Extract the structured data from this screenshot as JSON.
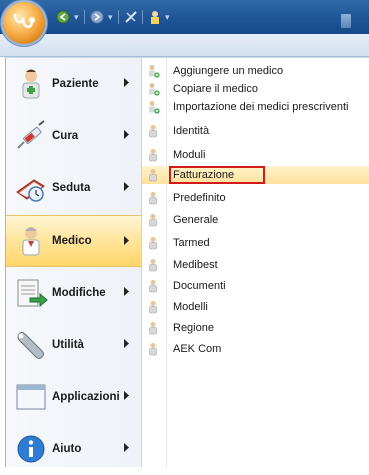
{
  "left_menu": [
    {
      "label": "Paziente",
      "icon": "patient-icon",
      "has_submenu": true
    },
    {
      "label": "Cura",
      "icon": "syringe-icon",
      "has_submenu": true
    },
    {
      "label": "Seduta",
      "icon": "calendar-clock-icon",
      "has_submenu": true
    },
    {
      "label": "Medico",
      "icon": "doctor-icon",
      "has_submenu": true,
      "active": true
    },
    {
      "label": "Modifiche",
      "icon": "export-document-icon",
      "has_submenu": true
    },
    {
      "label": "Utilità",
      "icon": "wrench-icon",
      "has_submenu": true
    },
    {
      "label": "Applicazioni",
      "icon": "window-icon",
      "has_submenu": true
    },
    {
      "label": "Aiuto",
      "icon": "info-icon",
      "has_submenu": true
    }
  ],
  "submenu": [
    {
      "label": "Aggiungere un medico",
      "icon": "doctor-add-icon"
    },
    {
      "label": "Copiare il medico",
      "icon": "doctor-add-icon"
    },
    {
      "label": "Importazione dei medici prescriventi",
      "icon": "doctor-add-icon"
    },
    {
      "label": "Identità",
      "icon": "doctor-icon"
    },
    {
      "label": "Moduli",
      "icon": "doctor-icon"
    },
    {
      "label": "Fatturazione",
      "icon": "doctor-icon",
      "highlighted": true
    },
    {
      "label": "Predefinito",
      "icon": "doctor-icon"
    },
    {
      "label": "Generale",
      "icon": "doctor-icon"
    },
    {
      "label": "Tarmed",
      "icon": "doctor-icon"
    },
    {
      "label": "Medibest",
      "icon": "doctor-icon"
    },
    {
      "label": "Documenti",
      "icon": "doctor-icon"
    },
    {
      "label": "Modelli",
      "icon": "doctor-icon"
    },
    {
      "label": "Regione",
      "icon": "doctor-icon"
    },
    {
      "label": "AEK Com",
      "icon": "doctor-icon"
    }
  ],
  "colors": {
    "titlebar": "#1f5597",
    "active_item": "#ffe49a",
    "highlight_border": "#d21a1a"
  }
}
